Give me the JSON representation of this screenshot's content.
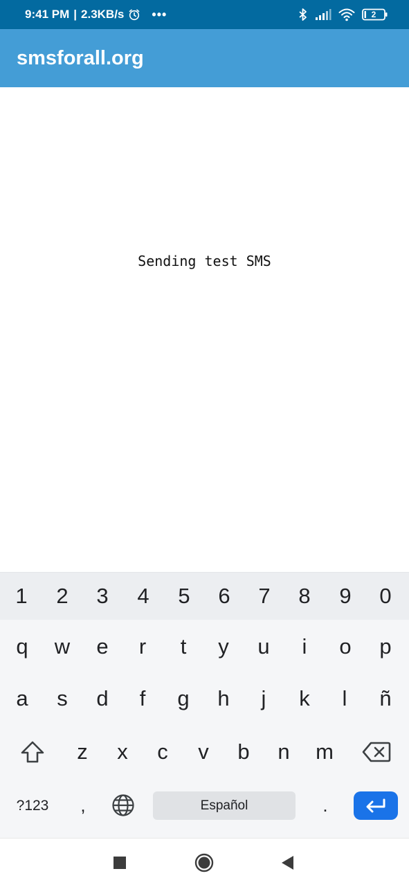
{
  "status_bar": {
    "time": "9:41 PM",
    "separator": "|",
    "network_speed": "2.3KB/s",
    "alarm_icon": "alarm-clock-icon",
    "more_icon": "more-dots-icon",
    "more_text": "•••",
    "bluetooth_icon": "bluetooth-icon",
    "signal_icon": "signal-icon",
    "wifi_icon": "wifi-icon",
    "battery_icon": "battery-icon",
    "battery_level": "2"
  },
  "app_bar": {
    "title": "smsforall.org",
    "background": "#449dd6"
  },
  "content": {
    "message": "Sending test SMS"
  },
  "keyboard": {
    "number_row": [
      "1",
      "2",
      "3",
      "4",
      "5",
      "6",
      "7",
      "8",
      "9",
      "0"
    ],
    "row1": [
      "q",
      "w",
      "e",
      "r",
      "t",
      "y",
      "u",
      "i",
      "o",
      "p"
    ],
    "row2": [
      "a",
      "s",
      "d",
      "f",
      "g",
      "h",
      "j",
      "k",
      "l",
      "ñ"
    ],
    "row3": [
      "z",
      "x",
      "c",
      "v",
      "b",
      "n",
      "m"
    ],
    "shift_icon": "shift-icon",
    "backspace_icon": "backspace-icon",
    "symbols_label": "?123",
    "comma_label": ",",
    "globe_icon": "globe-icon",
    "space_label": "Español",
    "period_label": ".",
    "enter_icon": "enter-icon",
    "enter_color": "#1a73e8"
  },
  "nav_bar": {
    "recents_icon": "square-recents-icon",
    "home_icon": "circle-home-icon",
    "back_icon": "triangle-back-icon"
  },
  "colors": {
    "status_bar": "#036aa0",
    "keyboard_bg": "#f5f6f8",
    "number_row_bg": "#eceef1"
  }
}
